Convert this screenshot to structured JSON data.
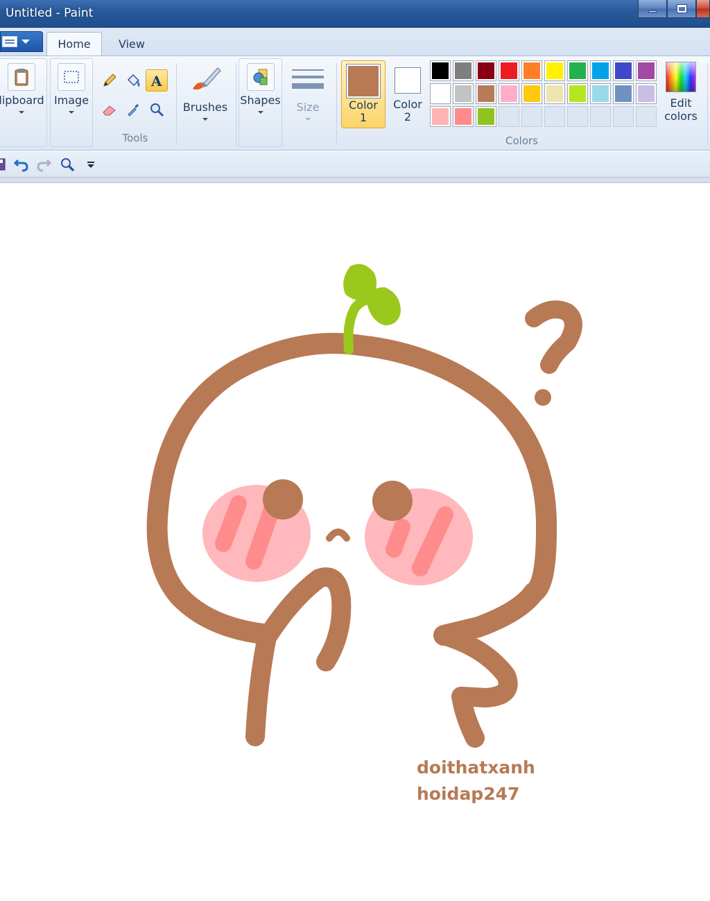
{
  "window": {
    "title": "Untitled - Paint"
  },
  "tabs": [
    {
      "label": "Home"
    },
    {
      "label": "View"
    }
  ],
  "ribbon": {
    "clipboard": {
      "label": "lipboard"
    },
    "image": {
      "label": "Image"
    },
    "tools": {
      "group_label": "Tools"
    },
    "brushes": {
      "label": "Brushes"
    },
    "shapes": {
      "label": "Shapes"
    },
    "size": {
      "label": "Size"
    },
    "color1": {
      "label_line1": "Color",
      "label_line2": "1",
      "value": "#b87955"
    },
    "color2": {
      "label_line1": "Color",
      "label_line2": "2",
      "value": "#ffffff"
    },
    "colors_group_label": "Colors",
    "edit_colors": {
      "label_line1": "Edit",
      "label_line2": "colors"
    },
    "palette": [
      "#000000",
      "#7f7f7f",
      "#880015",
      "#ed1c24",
      "#ff7f27",
      "#fff200",
      "#22b14c",
      "#00a2e8",
      "#3f48cc",
      "#a349a4",
      "#ffffff",
      "#c3c3c3",
      "#b97a57",
      "#ffaec9",
      "#ffc90e",
      "#efe4b0",
      "#b5e61d",
      "#99d9ea",
      "#7092be",
      "#c8bfe7",
      "#ffb3b3",
      "#ff8c8c",
      "#8fc31f",
      "",
      "",
      "",
      "",
      "",
      "",
      ""
    ]
  },
  "colors_used": {
    "brown": "#b87955",
    "green": "#9bc81c",
    "blush": "#ffb8bc",
    "blush_stroke": "#ff8c8c"
  },
  "canvas": {
    "signature_line1": "doithatxanh",
    "signature_line2": "hoidap247"
  }
}
